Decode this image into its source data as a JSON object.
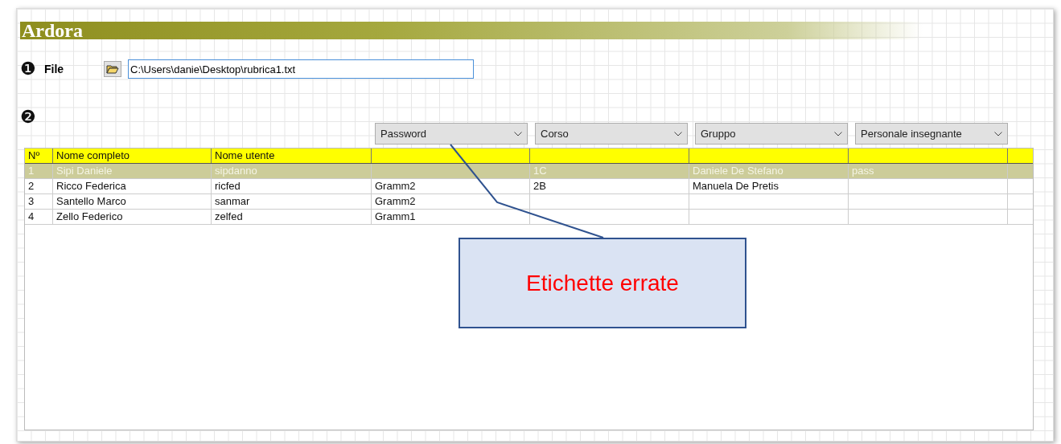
{
  "app_title": "Ardora",
  "file": {
    "step": "❶",
    "label": "File",
    "path": "C:\\Users\\danie\\Desktop\\rubrica1.txt"
  },
  "step_2": "❷",
  "dropdowns": [
    {
      "value": "Password"
    },
    {
      "value": "Corso"
    },
    {
      "value": "Gruppo"
    },
    {
      "value": "Personale insegnante"
    }
  ],
  "table": {
    "columns": [
      "Nº",
      "Nome completo",
      "Nome utente"
    ],
    "rows": [
      {
        "selected": true,
        "cells": {
          "n": "1",
          "nome_completo": "Sipi Daniele",
          "nome_utente": "sipdanno",
          "column_5": "1C",
          "column_6": "Daniele De Stefano",
          "column_7": "pass"
        }
      },
      {
        "selected": false,
        "cells": {
          "n": "2",
          "nome_completo": "Ricco Federica",
          "nome_utente": "ricfed",
          "column_4": "Gramm2",
          "column_5": "2B",
          "column_6": "Manuela De Pretis"
        }
      },
      {
        "selected": false,
        "cells": {
          "n": "3",
          "nome_completo": "Santello Marco",
          "nome_utente": "sanmar",
          "column_4": "Gramm2"
        }
      },
      {
        "selected": false,
        "cells": {
          "n": "4",
          "nome_completo": "Zello Federico",
          "nome_utente": "zelfed",
          "column_4": "Gramm1"
        }
      }
    ]
  },
  "callout": {
    "text": "Etichette errate"
  }
}
